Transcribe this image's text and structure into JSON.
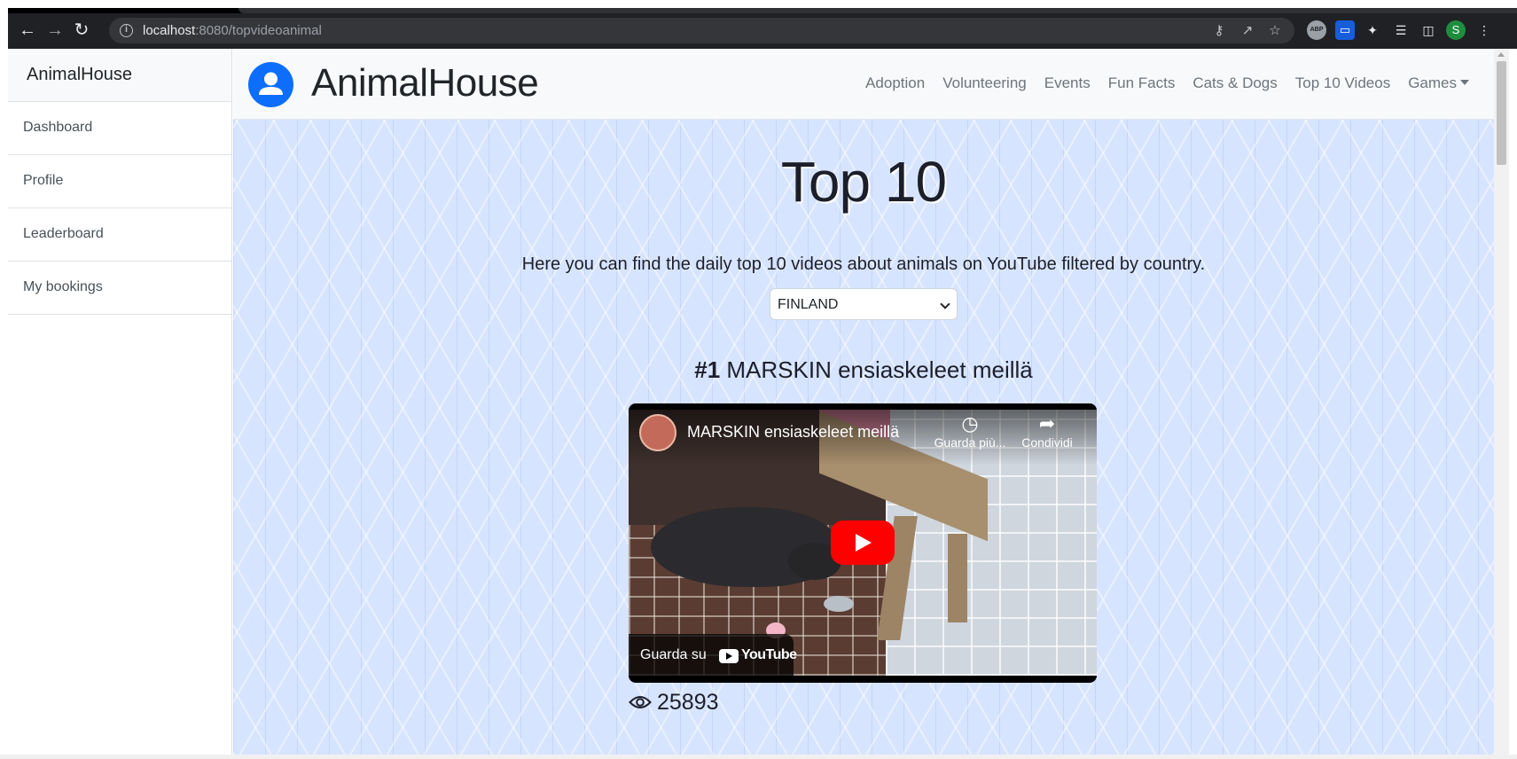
{
  "browser": {
    "url_host": "localhost",
    "url_rest": ":8080/topvideoanimal",
    "profile_initial": "S",
    "extensions": [
      "ABP"
    ]
  },
  "sidebar": {
    "brand": "AnimalHouse",
    "items": [
      {
        "label": "Dashboard"
      },
      {
        "label": "Profile"
      },
      {
        "label": "Leaderboard"
      },
      {
        "label": "My bookings"
      }
    ]
  },
  "navbar": {
    "title": "AnimalHouse",
    "links": [
      {
        "label": "Adoption"
      },
      {
        "label": "Volunteering"
      },
      {
        "label": "Events"
      },
      {
        "label": "Fun Facts"
      },
      {
        "label": "Cats & Dogs"
      },
      {
        "label": "Top 10 Videos"
      },
      {
        "label": "Games"
      }
    ]
  },
  "page": {
    "heading": "Top 10",
    "subtitle": "Here you can find the daily top 10 videos about animals on YouTube filtered by country.",
    "country_selected": "FINLAND"
  },
  "video": {
    "rank": "#1",
    "title": "MARSKIN ensiaskeleet meillä",
    "embed_title": "MARSKIN ensiaskeleet meillä",
    "watch_later": "Guarda più...",
    "share": "Condividi",
    "watch_on": "Guarda su",
    "youtube_word": "YouTube",
    "views": "25893"
  },
  "colors": {
    "accent": "#0d6efd",
    "youtube_red": "#ff0000",
    "background_pattern": "#d7e4ff"
  }
}
